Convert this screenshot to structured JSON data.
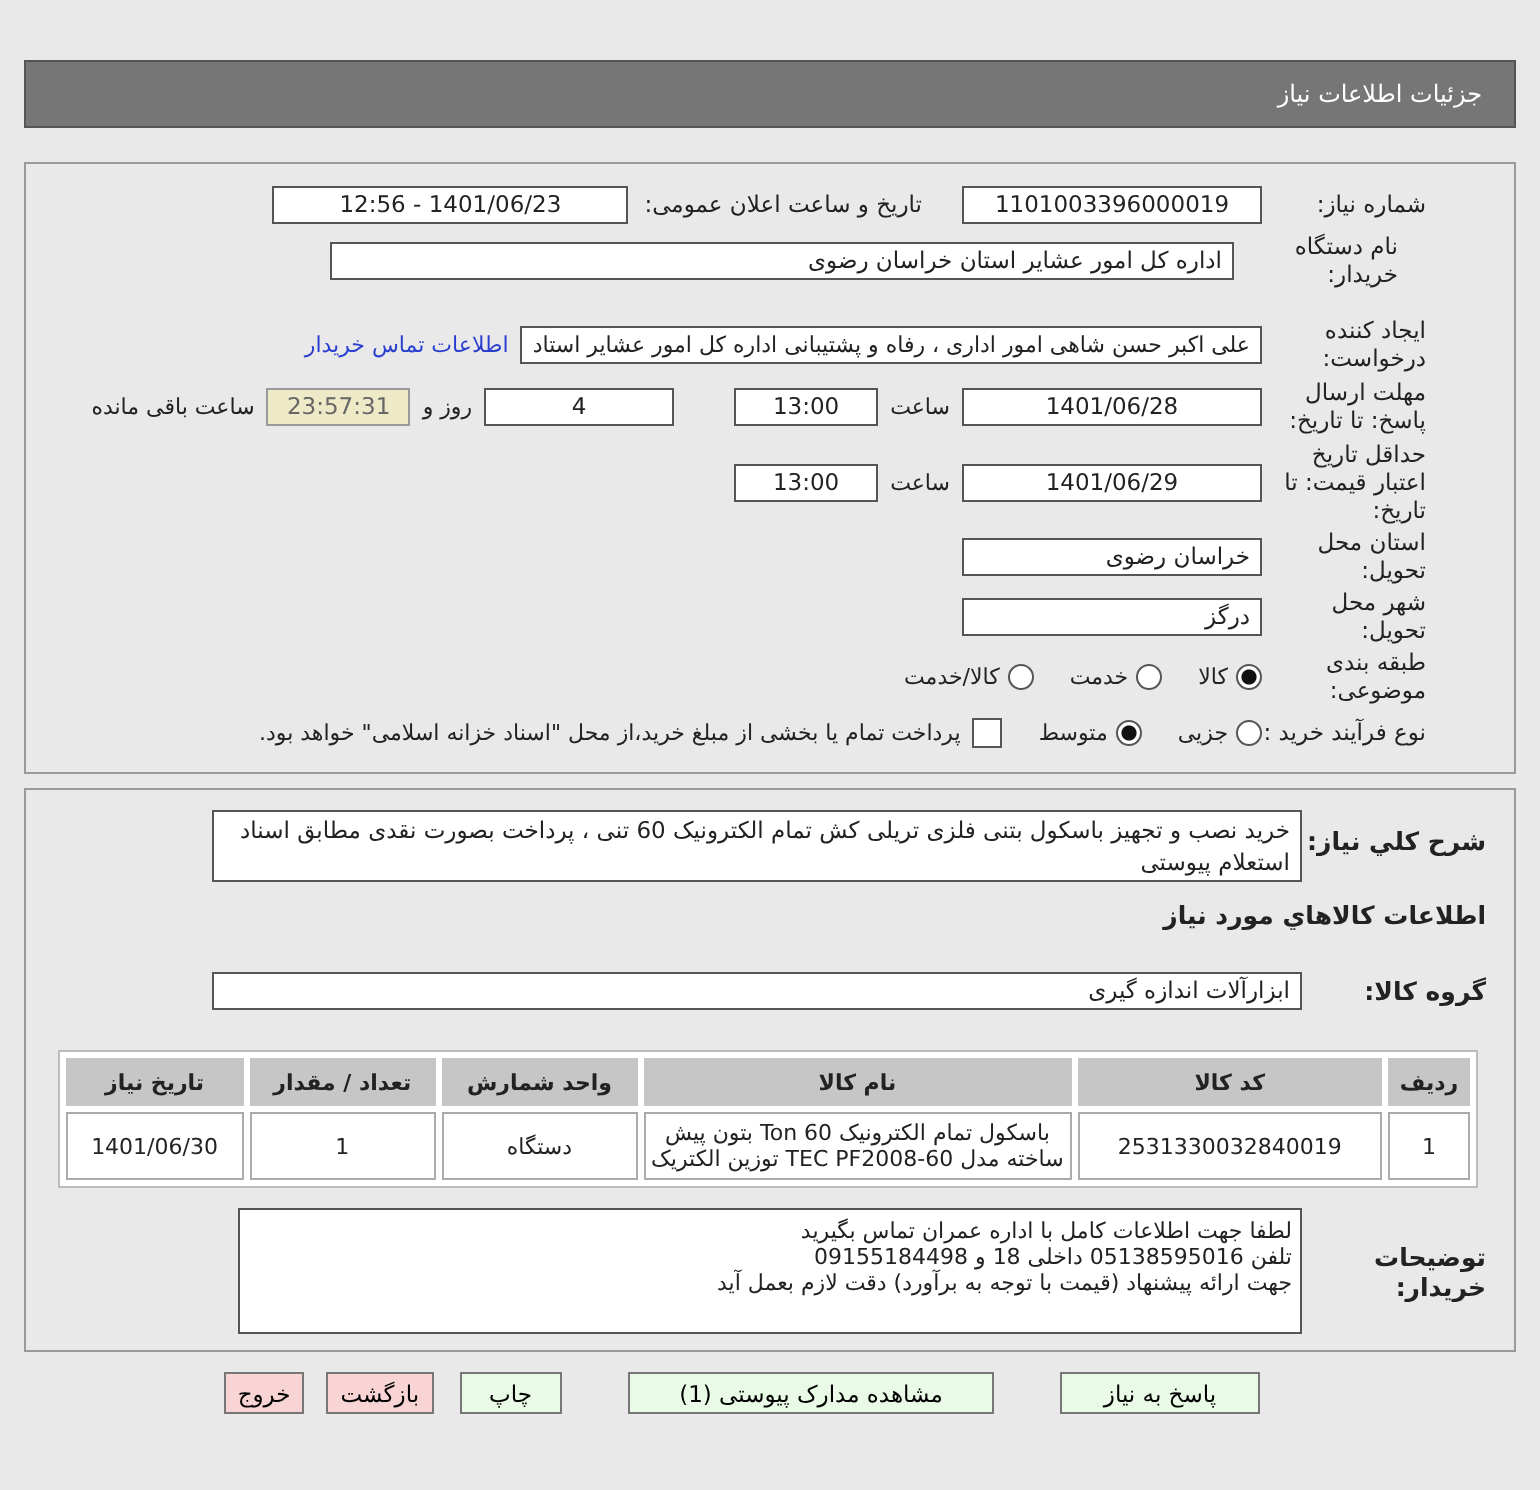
{
  "header": {
    "title": "جزئیات اطلاعات نیاز"
  },
  "need_number": {
    "label": "شماره نیاز:",
    "value": "1101003396000019"
  },
  "announce": {
    "label": "تاریخ و ساعت اعلان عمومی:",
    "value": "1401/06/23 - 12:56"
  },
  "buyer_org": {
    "label": "نام دستگاه خریدار:",
    "value": "اداره کل امور عشایر استان خراسان رضوی"
  },
  "requester": {
    "label": "ایجاد کننده درخواست:",
    "value": "علی اکبر حسن شاهی امور اداری ، رفاه و پشتیبانی اداره کل امور عشایر استاد",
    "link": "اطلاعات تماس خریدار"
  },
  "reply_deadline": {
    "label": "مهلت ارسال پاسخ: تا تاریخ:",
    "date": "1401/06/28",
    "time_label": "ساعت",
    "time": "13:00",
    "days": "4",
    "days_label": "روز و",
    "remaining": "23:57:31",
    "remaining_label": "ساعت باقی مانده"
  },
  "validity": {
    "label": "حداقل تاریخ اعتبار قیمت: تا تاریخ:",
    "date": "1401/06/29",
    "time_label": "ساعت",
    "time": "13:00"
  },
  "province": {
    "label": "استان محل تحویل:",
    "value": "خراسان رضوی"
  },
  "city": {
    "label": "شهر محل تحویل:",
    "value": "درگز"
  },
  "category": {
    "label": "طبقه بندی موضوعی:",
    "options": [
      {
        "label": "کالا",
        "selected": true
      },
      {
        "label": "خدمت",
        "selected": false
      },
      {
        "label": "کالا/خدمت",
        "selected": false
      }
    ]
  },
  "purchase_type": {
    "label": "نوع فرآیند خرید :",
    "options": [
      {
        "label": "جزیی",
        "selected": false
      },
      {
        "label": "متوسط",
        "selected": true
      }
    ],
    "payment": {
      "label": "پرداخت تمام یا بخشی از مبلغ خرید،از محل \"اسناد خزانه اسلامی\" خواهد بود.",
      "checked": false
    }
  },
  "description": {
    "label": "شرح کلي نياز:",
    "value": "خرید نصب و تجهیز باسکول بتنی فلزی تریلی کش تمام الکترونیک 60 تنی ، پرداخت بصورت نقدی مطابق اسناد استعلام پیوستی"
  },
  "goods_title": "اطلاعات کالاهاي مورد نياز",
  "goods_group": {
    "label": "گروه کالا:",
    "value": "ابزارآلات اندازه گیری"
  },
  "table": {
    "columns": [
      "ردیف",
      "کد کالا",
      "نام کالا",
      "واحد شمارش",
      "تعداد / مقدار",
      "تاریخ نیاز"
    ],
    "rows": [
      [
        "1",
        "2531330032840019",
        "باسکول تمام الکترونیک Ton 60 بتون پیش ساخته مدل TEC PF2008-60 توزین الکتریک",
        "دستگاه",
        "1",
        "1401/06/30"
      ]
    ]
  },
  "buyer_notes": {
    "label": "توضیحات خریدار:",
    "lines": [
      "لطفا جهت اطلاعات کامل با اداره عمران تماس بگیرید",
      "تلفن 05138595016 داخلی 18 و 09155184498",
      "جهت ارائه پیشنهاد (قیمت با توجه به برآورد) دقت لازم  بعمل آید"
    ]
  },
  "buttons": [
    {
      "label": "پاسخ به نیاز",
      "kind": "primary"
    },
    {
      "label": "مشاهده مدارک پیوستی (1)",
      "kind": "primary"
    },
    {
      "label": "چاپ",
      "kind": "primary"
    },
    {
      "label": "بازگشت",
      "kind": "danger"
    },
    {
      "label": "خروج",
      "kind": "danger"
    }
  ]
}
